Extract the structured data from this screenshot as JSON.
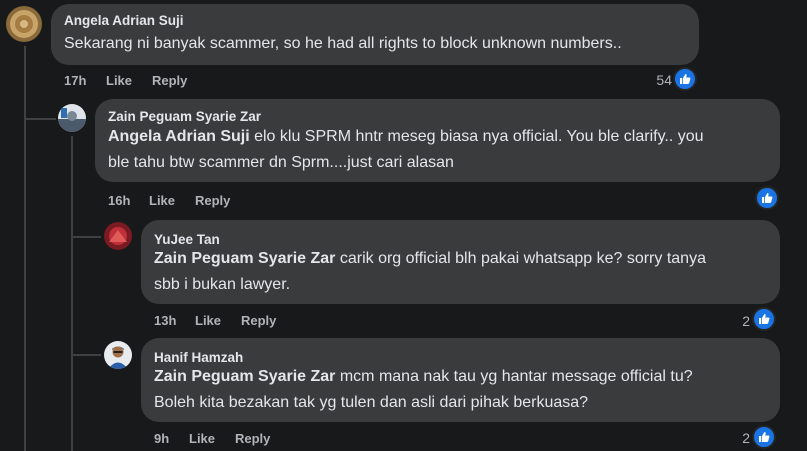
{
  "comments": [
    {
      "author": "Angela Adrian Suji",
      "text": "Sekarang ni banyak scammer, so he had all rights to block unknown numbers..",
      "time": "17h",
      "like_label": "Like",
      "reply_label": "Reply",
      "reaction_count": "54",
      "avatar_color": "#b08a4a"
    },
    {
      "author": "Zain Peguam Syarie Zar",
      "mention": "Angela Adrian Suji",
      "text_line1": " elo klu SPRM hntr meseg biasa nya official. You ble clarify.. you",
      "text_line2": "ble tahu btw scammer dn Sprm....just cari alasan",
      "time": "16h",
      "like_label": "Like",
      "reply_label": "Reply",
      "reaction_count": "",
      "avatar_color": "#6b7b8c"
    },
    {
      "author": "YuJee Tan",
      "mention": "Zain Peguam Syarie Zar",
      "text_line1": " carik org official blh pakai whatsapp ke? sorry tanya",
      "text_line2": "sbb i bukan lawyer.",
      "time": "13h",
      "like_label": "Like",
      "reply_label": "Reply",
      "reaction_count": "2",
      "avatar_color": "#c0303a"
    },
    {
      "author": "Hanif Hamzah",
      "mention": "Zain Peguam Syarie Zar",
      "text_line1": " mcm mana nak tau yg hantar message official tu?",
      "text_line2": "Boleh kita bezakan tak yg tulen dan asli dari pihak berkuasa?",
      "time": "9h",
      "like_label": "Like",
      "reply_label": "Reply",
      "reaction_count": "2",
      "avatar_color": "#e8ecef"
    }
  ],
  "colors": {
    "background": "#18191a",
    "bubble": "#3a3b3c",
    "like_blue": "#1b74e4",
    "secondary_text": "#b0b3b8"
  }
}
